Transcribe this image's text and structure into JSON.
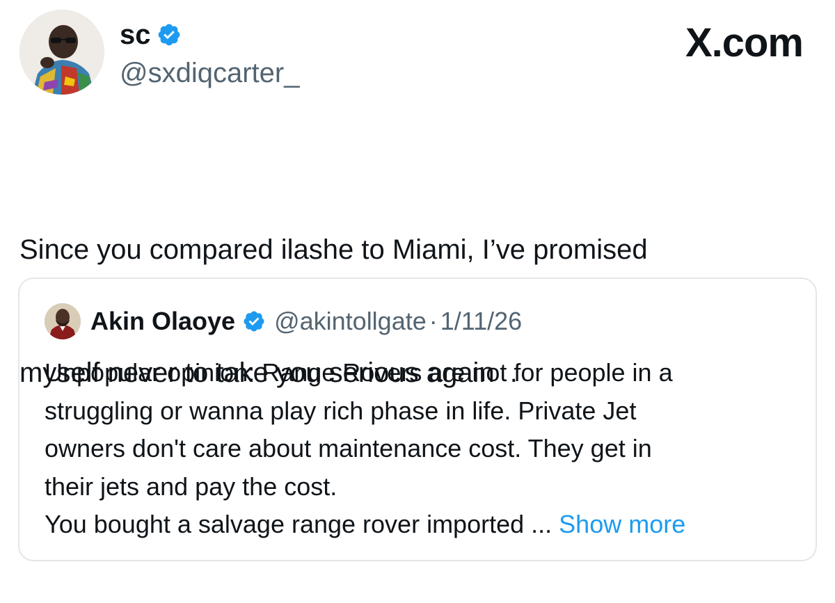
{
  "author": {
    "display_name": "sc",
    "handle": "@sxdiqcarter_",
    "verified": true
  },
  "brand": {
    "text": "X.com"
  },
  "tweet": {
    "lines": [
      "Since you compared ilashe to Miami, I’ve promised",
      "myself never to take you serious again  ."
    ]
  },
  "quoted_tweet": {
    "display_name": "Akin Olaoye",
    "handle": "@akintollgate",
    "separator": "·",
    "date": "1/11/26",
    "lines": [
      "Unpopular opinion: Range Rovers are not for people in a",
      "struggling or wanna play rich phase in life. Private Jet",
      "owners don't care about maintenance cost. They get in",
      "their jets and pay the cost."
    ],
    "last_line": "You bought a salvage range rover imported ...",
    "show_more": "Show more"
  },
  "colors": {
    "text": "#0f1419",
    "secondary": "#536471",
    "verified_badge": "#1d9bf0",
    "link": "#1d9bf0",
    "border": "#e3e6e9"
  },
  "icons": {
    "verified": "verified-badge-icon"
  }
}
